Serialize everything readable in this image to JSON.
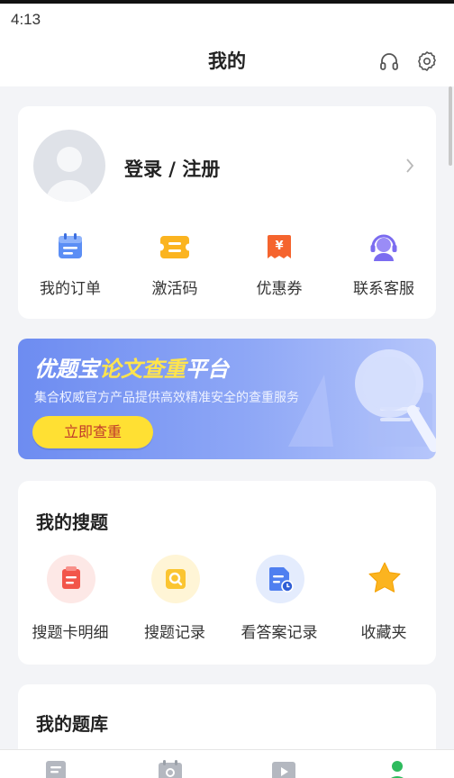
{
  "status_bar": {
    "time": "4:13"
  },
  "header": {
    "title": "我的",
    "icons": [
      "headset-icon",
      "gear-icon"
    ]
  },
  "profile": {
    "login_label": "登录 / 注册",
    "quick_actions": [
      {
        "label": "我的订单",
        "icon": "order-icon"
      },
      {
        "label": "激活码",
        "icon": "activation-code-icon"
      },
      {
        "label": "优惠券",
        "icon": "coupon-icon"
      },
      {
        "label": "联系客服",
        "icon": "customer-service-icon"
      }
    ]
  },
  "banner": {
    "title_part1": "优题宝",
    "title_part2": "论文查重",
    "title_part3": "平台",
    "subtitle": "集合权威官方产品提供高效精准安全的查重服务",
    "button_label": "立即查重"
  },
  "my_search": {
    "title": "我的搜题",
    "items": [
      {
        "label": "搜题卡明细",
        "icon": "search-card-icon"
      },
      {
        "label": "搜题记录",
        "icon": "search-record-icon"
      },
      {
        "label": "看答案记录",
        "icon": "answer-record-icon"
      },
      {
        "label": "收藏夹",
        "icon": "star-icon"
      }
    ]
  },
  "question_bank": {
    "title": "我的题库"
  },
  "tab_bar": {
    "icons": [
      "tab-document-icon",
      "tab-calendar-search-icon",
      "tab-video-icon",
      "tab-profile-icon"
    ]
  },
  "colors": {
    "accent_green": "#2dbb5d",
    "banner_blue": "#6d8cf1",
    "banner_yellow": "#ffe033",
    "coupon_orange": "#f5642e",
    "activation_yellow": "#fbb420"
  }
}
